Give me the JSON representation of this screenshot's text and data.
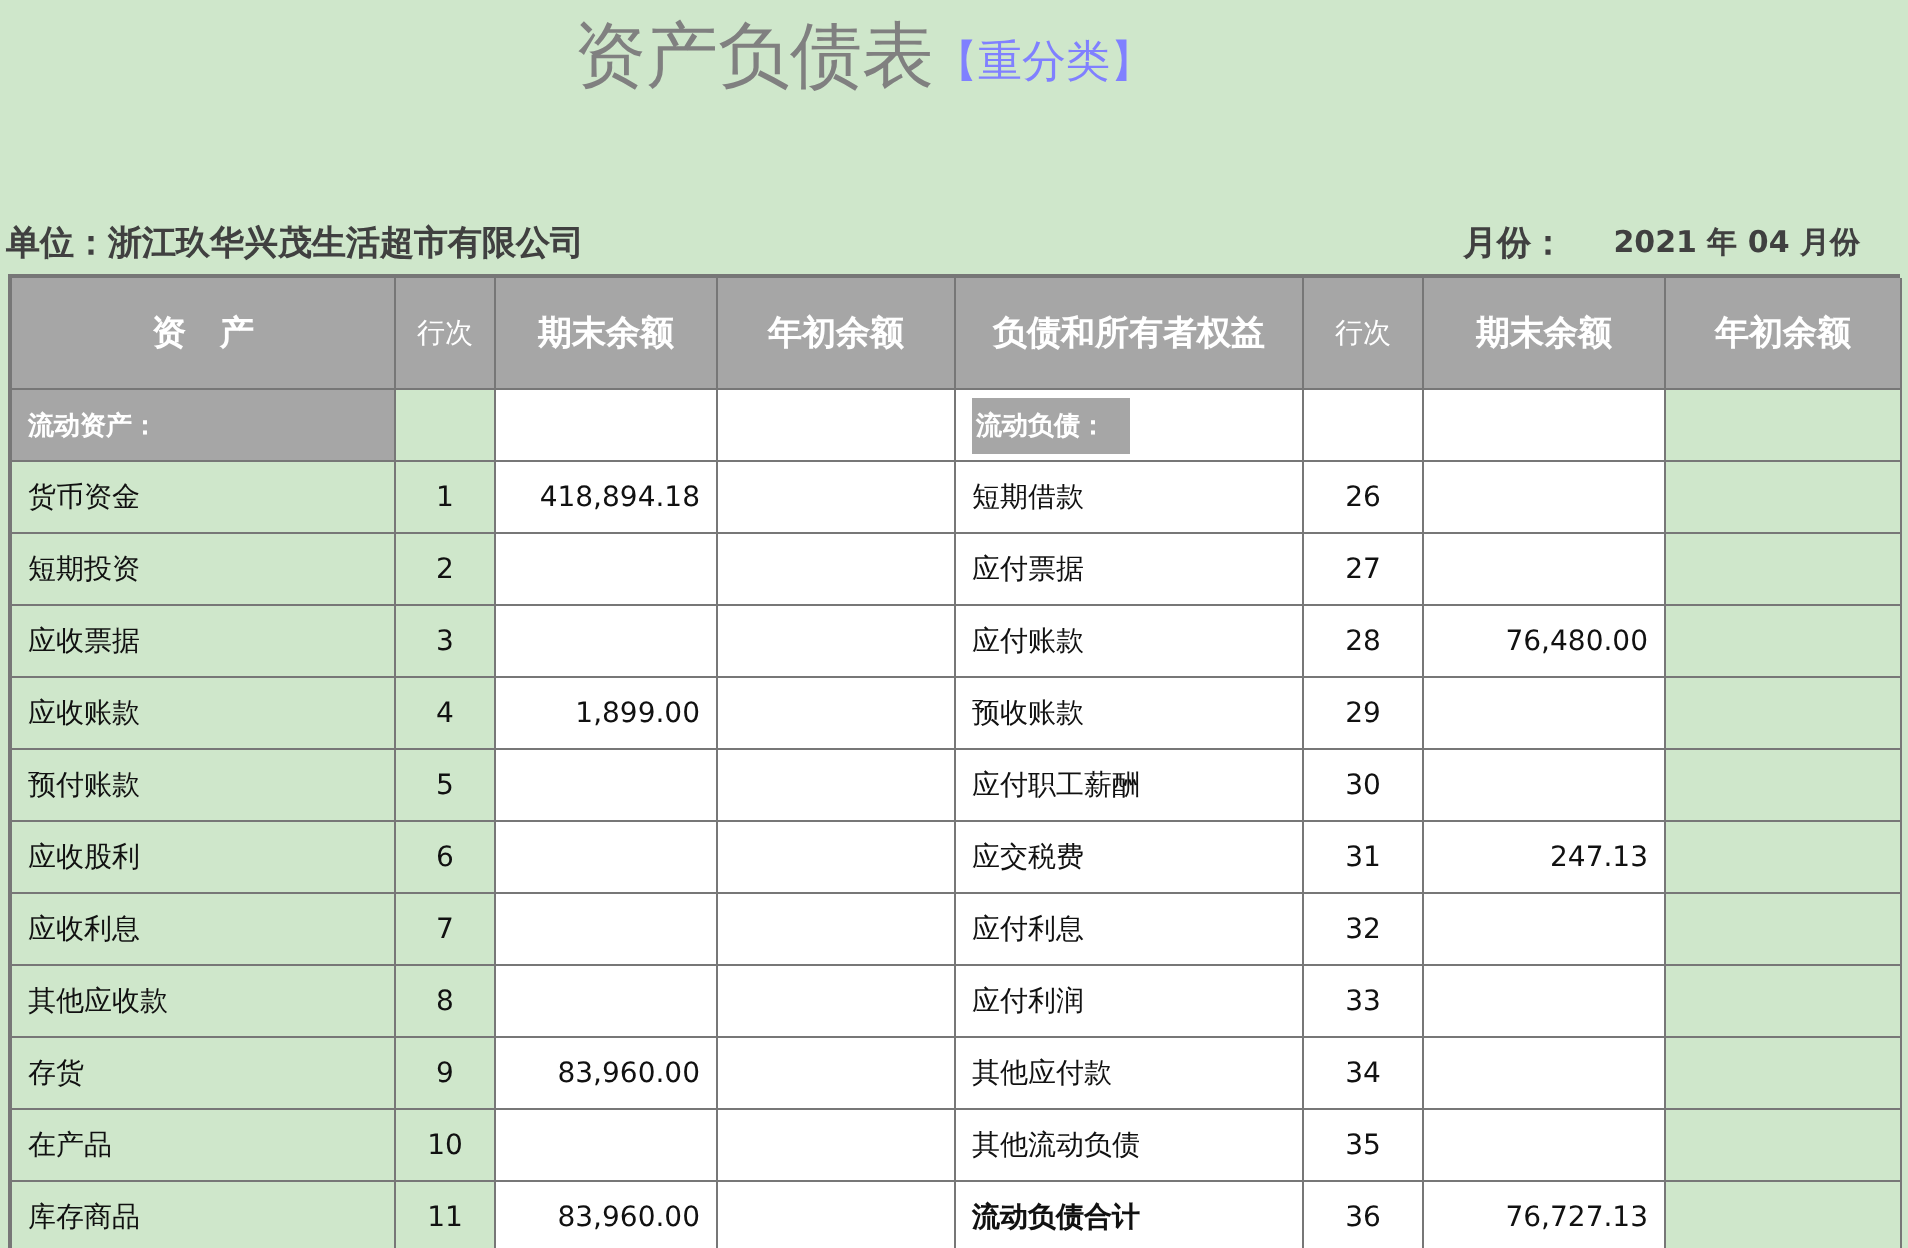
{
  "title": {
    "main": "资产负债表",
    "tag": "【重分类】"
  },
  "unit": {
    "label": "单位：浙江玖华兴茂生活超市有限公司",
    "month_label": "月份：",
    "month_value": "2021 年 04 月份"
  },
  "columns": [
    "资　产",
    "行次",
    "期末余额",
    "年初余额",
    "负债和所有者权益",
    "行次",
    "期末余额",
    "年初余额"
  ],
  "rows": [
    {
      "left": {
        "kind": "section",
        "name": "流动资产："
      },
      "right": {
        "kind": "section",
        "name": "流动负债："
      }
    },
    {
      "left": {
        "kind": "item",
        "name": "货币资金",
        "line": "1",
        "end": "418,894.18"
      },
      "right": {
        "kind": "item",
        "name": "短期借款",
        "line": "26"
      }
    },
    {
      "left": {
        "kind": "item",
        "name": "短期投资",
        "line": "2"
      },
      "right": {
        "kind": "item",
        "name": "应付票据",
        "line": "27"
      }
    },
    {
      "left": {
        "kind": "item",
        "name": "应收票据",
        "line": "3"
      },
      "right": {
        "kind": "item",
        "name": "应付账款",
        "line": "28",
        "end": "76,480.00"
      }
    },
    {
      "left": {
        "kind": "item",
        "name": "应收账款",
        "line": "4",
        "end": "1,899.00"
      },
      "right": {
        "kind": "item",
        "name": "预收账款",
        "line": "29"
      }
    },
    {
      "left": {
        "kind": "item",
        "name": "预付账款",
        "line": "5"
      },
      "right": {
        "kind": "item",
        "name": "应付职工薪酬",
        "line": "30"
      }
    },
    {
      "left": {
        "kind": "item",
        "name": "应收股利",
        "line": "6"
      },
      "right": {
        "kind": "item",
        "name": "应交税费",
        "line": "31",
        "end": "247.13"
      }
    },
    {
      "left": {
        "kind": "item",
        "name": "应收利息",
        "line": "7"
      },
      "right": {
        "kind": "item",
        "name": "应付利息",
        "line": "32"
      }
    },
    {
      "left": {
        "kind": "item",
        "name": "其他应收款",
        "line": "8"
      },
      "right": {
        "kind": "item",
        "name": "应付利润",
        "line": "33"
      }
    },
    {
      "left": {
        "kind": "item",
        "name": "存货",
        "line": "9",
        "end": "83,960.00"
      },
      "right": {
        "kind": "item",
        "name": "其他应付款",
        "line": "34"
      }
    },
    {
      "left": {
        "kind": "item",
        "name": "在产品",
        "line": "10"
      },
      "right": {
        "kind": "item",
        "name": "其他流动负债",
        "line": "35"
      }
    },
    {
      "left": {
        "kind": "item",
        "name": "库存商品",
        "line": "11",
        "end": "83,960.00"
      },
      "right": {
        "kind": "total",
        "name": "流动负债合计",
        "line": "36",
        "end": "76,727.13"
      }
    }
  ]
}
